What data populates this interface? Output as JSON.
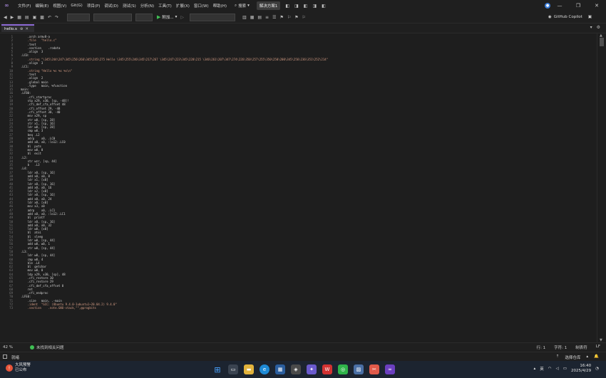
{
  "menu": {
    "file": "文件(F)",
    "edit": "编辑(E)",
    "view": "视图(V)",
    "git": "Git(G)",
    "project": "项目(P)",
    "debug": "调试(D)",
    "test": "测试(S)",
    "analyze": "分析(N)",
    "tools": "工具(T)",
    "extensions": "扩展(X)",
    "window": "窗口(W)",
    "help": "帮助(H)"
  },
  "search": {
    "label": "搜索"
  },
  "solution_name": "解决方案1",
  "toolbar": {
    "attach_label": "附加..."
  },
  "copilot_label": "GitHub Copilot",
  "tab": {
    "title": "hello.s"
  },
  "editor": {
    "lines": [
      {
        "n": "1",
        "code": "    .arch armv8-a"
      },
      {
        "n": "2",
        "code": "    .file   \"hello.c\""
      },
      {
        "n": "3",
        "code": "    .text"
      },
      {
        "n": "4",
        "code": "    .section    .rodata"
      },
      {
        "n": "5",
        "code": "    .align  3"
      },
      {
        "n": "6",
        "code": ".LC0:"
      },
      {
        "n": "7",
        "code": "    .string \"\\345\\244\\247\\345\\256\\266\\345\\245\\275 Hello \\345\\255\\246\\345\\217\\267 \\345\\247\\223\\345\\220\\215 \\346\\261\\207\\347\\274\\226\\350\\257\\255\\350\\250\\200\\345\\256\\236\\351\\252\\214\""
      },
      {
        "n": "8",
        "code": "    .align  3"
      },
      {
        "n": "9",
        "code": ".LC1:"
      },
      {
        "n": "10",
        "code": "    .string \"Hello %s %s %s\\n\""
      },
      {
        "n": "11",
        "code": "    .text"
      },
      {
        "n": "12",
        "code": "    .align  2"
      },
      {
        "n": "13",
        "code": "    .global main"
      },
      {
        "n": "14",
        "code": "    .type   main, %function"
      },
      {
        "n": "15",
        "code": "main:"
      },
      {
        "n": "16",
        "code": ".LFB0:"
      },
      {
        "n": "17",
        "code": "    .cfi_startproc"
      },
      {
        "n": "18",
        "code": "    stp x29, x30, [sp, -48]!"
      },
      {
        "n": "19",
        "code": "    .cfi_def_cfa_offset 48"
      },
      {
        "n": "20",
        "code": "    .cfi_offset 29, -48"
      },
      {
        "n": "21",
        "code": "    .cfi_offset 30, -40"
      },
      {
        "n": "22",
        "code": "    mov x29, sp"
      },
      {
        "n": "23",
        "code": "    str w0, [sp, 28]"
      },
      {
        "n": "24",
        "code": "    str x1, [sp, 16]"
      },
      {
        "n": "25",
        "code": "    ldr w0, [sp, 28]"
      },
      {
        "n": "26",
        "code": "    cmp w0, 3"
      },
      {
        "n": "27",
        "code": "    beq .L2"
      },
      {
        "n": "28",
        "code": "    adrp    x0, .LC0"
      },
      {
        "n": "29",
        "code": "    add x0, x0, :lo12:.LC0"
      },
      {
        "n": "30",
        "code": "    bl  puts"
      },
      {
        "n": "31",
        "code": "    mov w0, 0"
      },
      {
        "n": "32",
        "code": "    bl  exit"
      },
      {
        "n": "33",
        "code": ".L2:"
      },
      {
        "n": "34",
        "code": "    str wzr, [sp, 44]"
      },
      {
        "n": "35",
        "code": "    b   .L3"
      },
      {
        "n": "36",
        "code": ".L4:"
      },
      {
        "n": "37",
        "code": "    ldr x0, [sp, 16]"
      },
      {
        "n": "38",
        "code": "    add x0, x0, 8"
      },
      {
        "n": "39",
        "code": "    ldr x1, [x0]"
      },
      {
        "n": "40",
        "code": "    ldr x0, [sp, 16]"
      },
      {
        "n": "41",
        "code": "    add x0, x0, 16"
      },
      {
        "n": "42",
        "code": "    ldr x2, [x0]"
      },
      {
        "n": "43",
        "code": "    ldr x0, [sp, 16]"
      },
      {
        "n": "44",
        "code": "    add x0, x0, 24"
      },
      {
        "n": "45",
        "code": "    ldr x0, [x0]"
      },
      {
        "n": "46",
        "code": "    mov x3, x0"
      },
      {
        "n": "47",
        "code": "    adrp    x0, .LC1"
      },
      {
        "n": "48",
        "code": "    add x0, x0, :lo12:.LC1"
      },
      {
        "n": "49",
        "code": "    bl  printf"
      },
      {
        "n": "50",
        "code": "    ldr x0, [sp, 16]"
      },
      {
        "n": "51",
        "code": "    add x0, x0, 32"
      },
      {
        "n": "52",
        "code": "    ldr w0, [x0]"
      },
      {
        "n": "53",
        "code": "    bl  atoi"
      },
      {
        "n": "54",
        "code": "    bl  sleep"
      },
      {
        "n": "55",
        "code": "    ldr w0, [sp, 44]"
      },
      {
        "n": "56",
        "code": "    add w0, w0, 1"
      },
      {
        "n": "57",
        "code": "    str w0, [sp, 44]"
      },
      {
        "n": "58",
        "code": ".L3:"
      },
      {
        "n": "59",
        "code": "    ldr w0, [sp, 44]"
      },
      {
        "n": "60",
        "code": "    cmp w0, 4"
      },
      {
        "n": "61",
        "code": "    ble .L4"
      },
      {
        "n": "62",
        "code": "    bl  getchar"
      },
      {
        "n": "63",
        "code": "    mov w0, 0"
      },
      {
        "n": "64",
        "code": "    ldp x29, x30, [sp], 48"
      },
      {
        "n": "65",
        "code": "    .cfi_restore 30"
      },
      {
        "n": "66",
        "code": "    .cfi_restore 29"
      },
      {
        "n": "67",
        "code": "    .cfi_def_cfa_offset 0"
      },
      {
        "n": "68",
        "code": "    ret"
      },
      {
        "n": "69",
        "code": "    .cfi_endproc"
      },
      {
        "n": "70",
        "code": ".LFE0:"
      },
      {
        "n": "71",
        "code": "    .size   main, .-main"
      },
      {
        "n": "72",
        "code": "    .ident  \"GCC: (Ubuntu 9.4.0-1ubuntu1~20.04.2) 9.4.0\""
      },
      {
        "n": "73",
        "code": "    .section    .note.GNU-stack,\"\",@progbits"
      }
    ]
  },
  "editor_status": {
    "zoom": "42 %",
    "issues": "未找到相关问题",
    "line": "行: 1",
    "char": "字符: 1",
    "mode": "制表符",
    "eol": "LF"
  },
  "statusbar": {
    "ready": "就绪",
    "repo": "选择仓库"
  },
  "taskbar": {
    "weather_title": "大风预警",
    "weather_sub": "已公布",
    "ime": "英",
    "time": "16:40",
    "date": "2025/4/29"
  },
  "colors": {
    "accent": "#8e6bd6",
    "run": "#3fbf54"
  }
}
